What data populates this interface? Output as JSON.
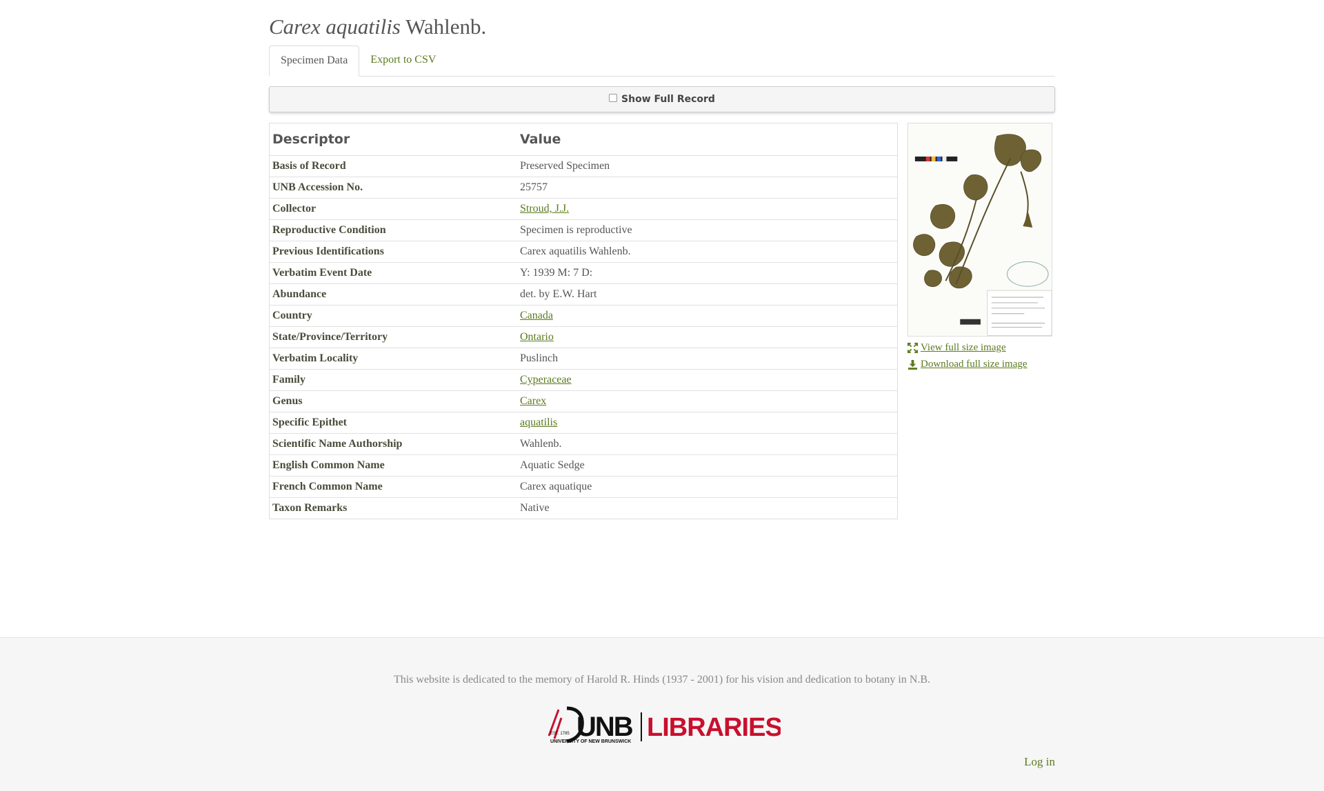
{
  "header": {
    "title_genus_species": "Carex aquatilis",
    "title_author": "Wahlenb."
  },
  "tabs": [
    {
      "label": "Specimen Data",
      "active": true
    },
    {
      "label": "Export to CSV",
      "active": false
    }
  ],
  "toggle": {
    "label": "Show Full Record",
    "checked": false
  },
  "table": {
    "headers": {
      "descriptor": "Descriptor",
      "value": "Value"
    },
    "rows": [
      {
        "descriptor": "Basis of Record",
        "value": "Preserved Specimen",
        "link": false
      },
      {
        "descriptor": "UNB Accession No.",
        "value": "25757",
        "link": false
      },
      {
        "descriptor": "Collector",
        "value": "Stroud, J.J.",
        "link": true
      },
      {
        "descriptor": "Reproductive Condition",
        "value": "Specimen is reproductive",
        "link": false
      },
      {
        "descriptor": "Previous Identifications",
        "value": "Carex aquatilis Wahlenb.",
        "link": false
      },
      {
        "descriptor": "Verbatim Event Date",
        "value": "Y: 1939 M: 7 D:",
        "link": false
      },
      {
        "descriptor": "Abundance",
        "value": "det. by E.W. Hart",
        "link": false
      },
      {
        "descriptor": "Country",
        "value": "Canada",
        "link": true
      },
      {
        "descriptor": "State/Province/Territory",
        "value": "Ontario",
        "link": true
      },
      {
        "descriptor": "Verbatim Locality",
        "value": "Puslinch",
        "link": false
      },
      {
        "descriptor": "Family",
        "value": "Cyperaceae",
        "link": true
      },
      {
        "descriptor": "Genus",
        "value": "Carex",
        "link": true
      },
      {
        "descriptor": "Specific Epithet",
        "value": "aquatilis",
        "link": true
      },
      {
        "descriptor": "Scientific Name Authorship",
        "value": "Wahlenb.",
        "link": false
      },
      {
        "descriptor": "English Common Name",
        "value": "Aquatic Sedge",
        "link": false
      },
      {
        "descriptor": "French Common Name",
        "value": "Carex aquatique",
        "link": false
      },
      {
        "descriptor": "Taxon Remarks",
        "value": "Native",
        "link": false
      }
    ]
  },
  "image_panel": {
    "view_label": "View full size image",
    "download_label": "Download full size image",
    "view_icon": "expand-icon",
    "download_icon": "download-icon"
  },
  "footer": {
    "dedication": "This website is dedicated to the memory of Harold R. Hinds (1937 - 2001) for his vision and dedication to botany in N.B.",
    "logo_text": {
      "est": "EST. 1785",
      "unb": "UNB",
      "sub": "UNIVERSITY OF NEW BRUNSWICK",
      "libraries": "LIBRARIES"
    },
    "login_label": "Log in"
  },
  "colors": {
    "link": "#5a7a1e",
    "logo_red": "#c8102e",
    "footer_bg": "#f6f6f6"
  }
}
